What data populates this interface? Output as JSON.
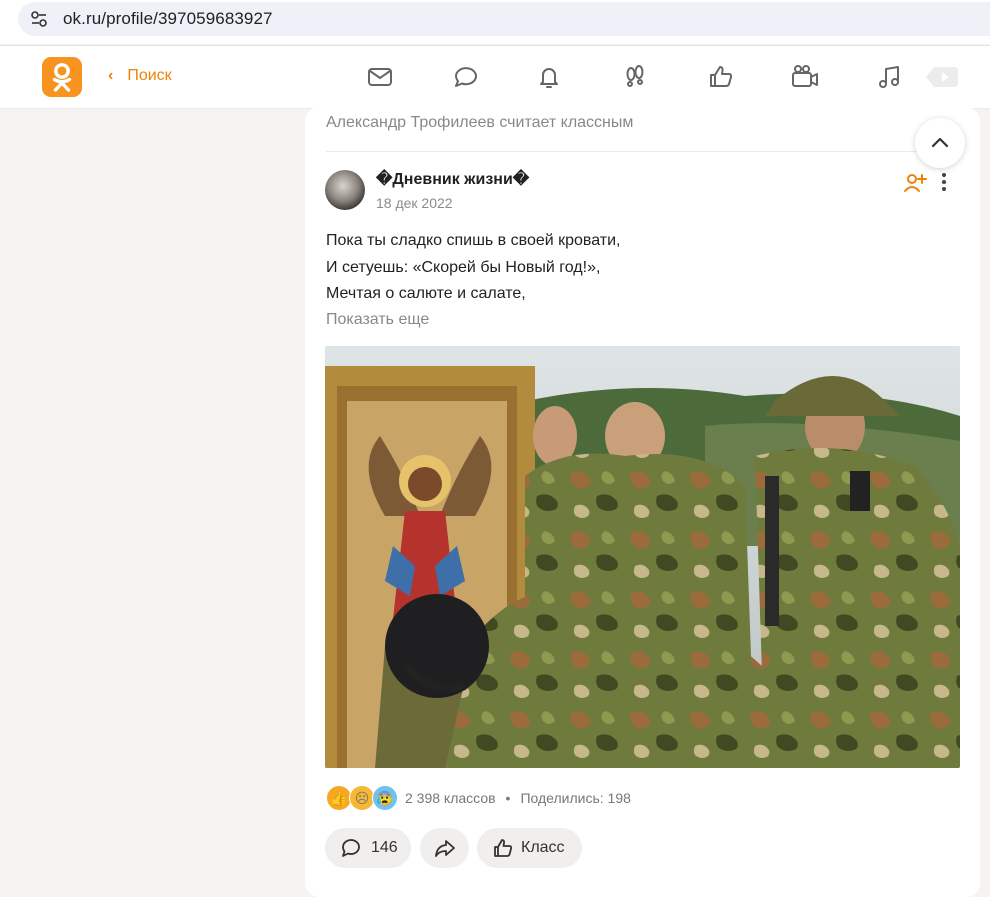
{
  "browser": {
    "url": "ok.ru/profile/397059683927"
  },
  "header": {
    "back_label": "Поиск",
    "nav_icons": [
      "messages-icon",
      "discussions-icon",
      "notifications-icon",
      "guests-icon",
      "likes-icon",
      "video-icon",
      "music-icon",
      "play-icon"
    ],
    "accent_color": "#ee8208"
  },
  "feed": {
    "liked_by": "Александр Трофилеев считает классным",
    "post": {
      "author": "�Дневник жизни�",
      "date": "18 дек 2022",
      "lines": [
        "Пока ты сладко спишь в своей кровати,",
        "И сетуешь: «Скорей бы Новый год!»,",
        "Мечтая о салюте и салате,"
      ],
      "show_more": "Показать еще",
      "reactions": [
        "like-emoji",
        "sad-emoji",
        "shocked-emoji"
      ],
      "klass_count": "2 398 классов",
      "separator": "•",
      "shared": "Поделились: 198",
      "comments_count": "146",
      "klass_label": "Класс"
    }
  }
}
